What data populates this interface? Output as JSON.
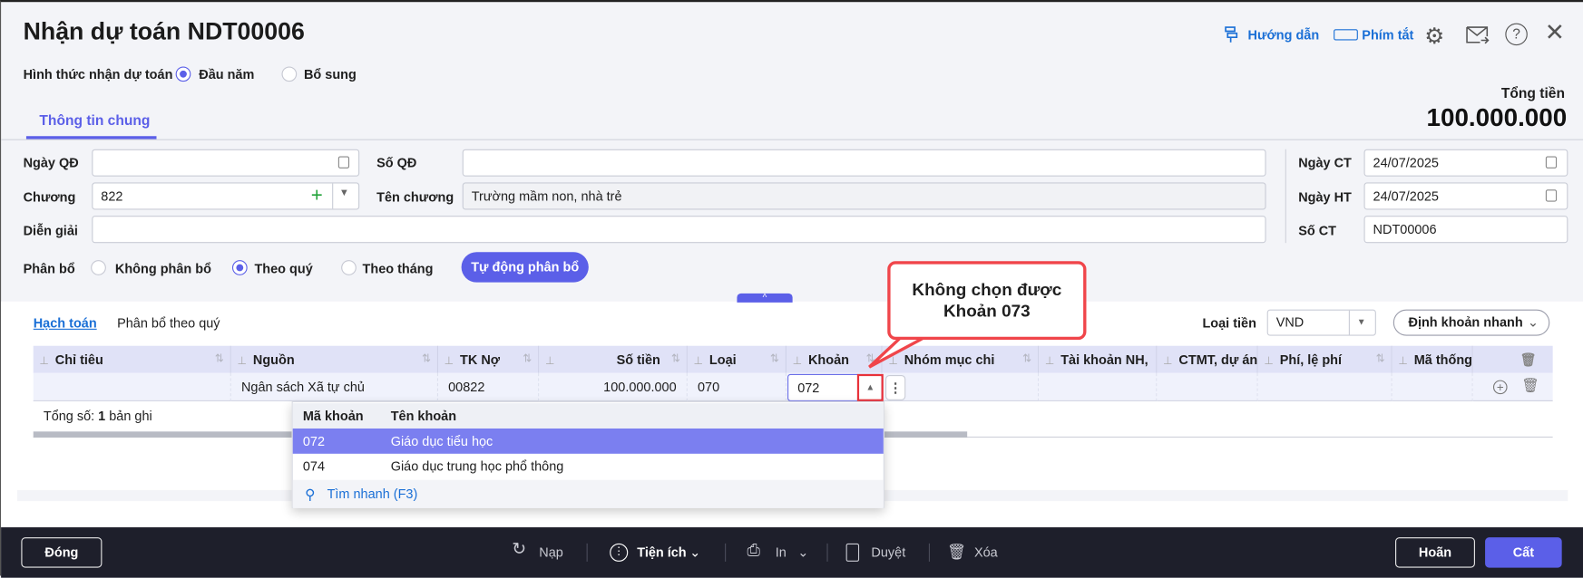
{
  "header": {
    "title": "Nhận dự toán NDT00006",
    "guide_label": "Hướng dẫn",
    "shortcut_label": "Phím tắt"
  },
  "receive_type": {
    "label": "Hình thức nhận dự toán",
    "options": [
      "Đầu năm",
      "Bổ sung"
    ],
    "selected": "Đầu năm"
  },
  "total": {
    "label": "Tổng tiền",
    "value": "100.000.000"
  },
  "tabs": [
    "Thông tin chung"
  ],
  "form": {
    "ngay_qd": {
      "label": "Ngày QĐ",
      "value": ""
    },
    "so_qd": {
      "label": "Số QĐ",
      "value": ""
    },
    "chuong": {
      "label": "Chương",
      "value": "822"
    },
    "ten_chuong": {
      "label": "Tên chương",
      "value": "Trường mầm non, nhà trẻ"
    },
    "dien_giai": {
      "label": "Diễn giải",
      "value": ""
    },
    "ngay_ct": {
      "label": "Ngày CT",
      "value": "24/07/2025"
    },
    "ngay_ht": {
      "label": "Ngày HT",
      "value": "24/07/2025"
    },
    "so_ct": {
      "label": "Số CT",
      "value": "NDT00006"
    },
    "phan_bo": {
      "label": "Phân bổ",
      "options": [
        "Không phân bổ",
        "Theo quý",
        "Theo tháng"
      ],
      "selected": "Theo quý"
    },
    "auto_button": "Tự động phân bổ"
  },
  "detail": {
    "tabs": [
      "Hạch toán",
      "Phân bổ theo quý"
    ],
    "currency_label": "Loại tiền",
    "currency": "VND",
    "quick_button": "Định khoản nhanh",
    "columns": [
      "Chỉ tiêu",
      "Nguồn",
      "TK Nợ",
      "Số tiền",
      "Loại",
      "Khoản",
      "Nhóm mục chi",
      "Tài khoản NH,",
      "CTMT, dự án",
      "Phí, lệ phí",
      "Mã thống"
    ],
    "row": {
      "chi_tieu": "",
      "nguon": "Ngân sách Xã tự chủ",
      "tk_no": "00822",
      "so_tien": "100.000.000",
      "loai": "070",
      "khoan": "072"
    },
    "summary_prefix": "Tổng số: ",
    "summary_count": "1",
    "summary_suffix": " bản ghi"
  },
  "dropdown": {
    "headers": [
      "Mã khoản",
      "Tên khoản"
    ],
    "items": [
      {
        "code": "072",
        "name": "Giáo dục tiểu học"
      },
      {
        "code": "074",
        "name": "Giáo dục trung học phổ thông"
      }
    ],
    "search": "Tìm nhanh (F3)"
  },
  "callout": {
    "line1": "Không chọn được",
    "line2": "Khoản 073"
  },
  "footer": {
    "close": "Đóng",
    "reload": "Nạp",
    "utilities": "Tiện ích",
    "print": "In",
    "approve": "Duyệt",
    "delete": "Xóa",
    "cancel": "Hoãn",
    "save": "Cất"
  },
  "colors": {
    "accent": "#5b5fe8",
    "link": "#1a6fd6",
    "callout": "#f0454a",
    "footer": "#1e1f2b"
  }
}
